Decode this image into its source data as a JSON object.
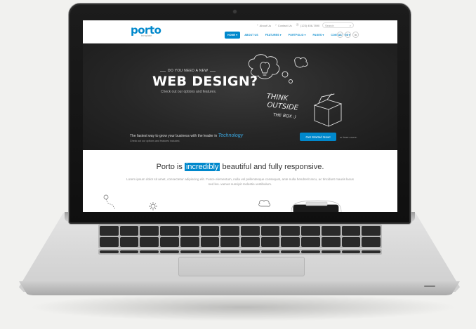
{
  "site": {
    "logo": "porto",
    "logo_sub": "template",
    "top_links": [
      {
        "icon": "angle-icon",
        "label": "About Us"
      },
      {
        "icon": "angle-icon",
        "label": "Contact Us"
      },
      {
        "icon": "phone-icon",
        "label": "(123) 456-7890"
      }
    ],
    "search_placeholder": "Search",
    "nav": [
      "HOME ▾",
      "ABOUT US",
      "FEATURES ▾",
      "PORTFOLIO ▾",
      "PAGES ▾",
      "CONTACT US ▾"
    ],
    "socials": [
      "f",
      "t",
      "in"
    ]
  },
  "hero": {
    "small_heading": "DO YOU NEED A NEW",
    "title": "WEB DESIGN?",
    "subtitle": "Check out our options and features.",
    "chalk_text": [
      "THINK",
      "OUTSIDE",
      "THE BOX :)"
    ]
  },
  "cta": {
    "line1": "The fastest way to grow your business with the leader in",
    "line1_highlight": "Technology",
    "line2": "Check out our options and features included.",
    "button": "Get Started Now!",
    "or_text": "or learn more."
  },
  "feature": {
    "title_before": "Porto is",
    "title_highlight": "incredibly",
    "title_after": "beautiful and fully responsive.",
    "body": "Lorem ipsum dolor sit amet, consectetur adipiscing elit. Fusce elementum, nulla vel pellentesque consequat, ante nulla hendrerit arcu, ac tincidunt mauris lacus sed leo. vamus suscipit molestie vestibulum."
  },
  "colors": {
    "brand": "#0088cc",
    "hero_bg": "#262626"
  }
}
